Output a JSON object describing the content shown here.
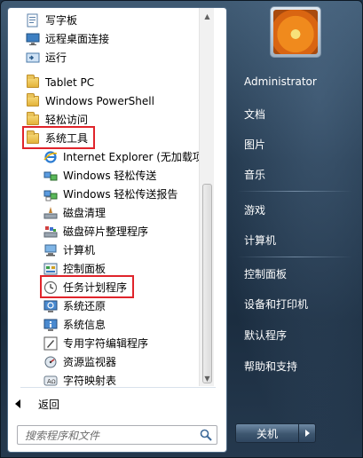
{
  "programs": {
    "items": [
      {
        "label": "写字板",
        "icon": "wordpad-icon"
      },
      {
        "label": "远程桌面连接",
        "icon": "remote-desktop-icon"
      },
      {
        "label": "运行",
        "icon": "run-icon"
      },
      {
        "label": "Tablet PC",
        "icon": "folder-icon"
      },
      {
        "label": "Windows PowerShell",
        "icon": "folder-icon"
      },
      {
        "label": "轻松访问",
        "icon": "folder-icon"
      },
      {
        "label": "系统工具",
        "icon": "folder-icon"
      },
      {
        "label": "Internet Explorer (无加载项)",
        "icon": "internet-explorer-icon"
      },
      {
        "label": "Windows 轻松传送",
        "icon": "easy-transfer-icon"
      },
      {
        "label": "Windows 轻松传送报告",
        "icon": "easy-transfer-report-icon"
      },
      {
        "label": "磁盘清理",
        "icon": "disk-cleanup-icon"
      },
      {
        "label": "磁盘碎片整理程序",
        "icon": "defragmenter-icon"
      },
      {
        "label": "计算机",
        "icon": "computer-icon"
      },
      {
        "label": "控制面板",
        "icon": "control-panel-icon"
      },
      {
        "label": "任务计划程序",
        "icon": "task-scheduler-icon"
      },
      {
        "label": "系统还原",
        "icon": "system-restore-icon"
      },
      {
        "label": "系统信息",
        "icon": "system-info-icon"
      },
      {
        "label": "专用字符编辑程序",
        "icon": "char-editor-icon"
      },
      {
        "label": "资源监视器",
        "icon": "resource-monitor-icon"
      },
      {
        "label": "字符映射表",
        "icon": "char-map-icon"
      }
    ],
    "highlighted": [
      "系统工具",
      "任务计划程序"
    ]
  },
  "back_label": "返回",
  "search": {
    "placeholder": "搜索程序和文件"
  },
  "right_menu": {
    "user": "Administrator",
    "documents": "文档",
    "pictures": "图片",
    "music": "音乐",
    "games": "游戏",
    "computer": "计算机",
    "control_panel": "控制面板",
    "devices_printers": "设备和打印机",
    "default_programs": "默认程序",
    "help_support": "帮助和支持"
  },
  "shutdown": {
    "label": "关机"
  },
  "colors": {
    "highlight": "#e0242b",
    "accent": "#1d3146"
  }
}
